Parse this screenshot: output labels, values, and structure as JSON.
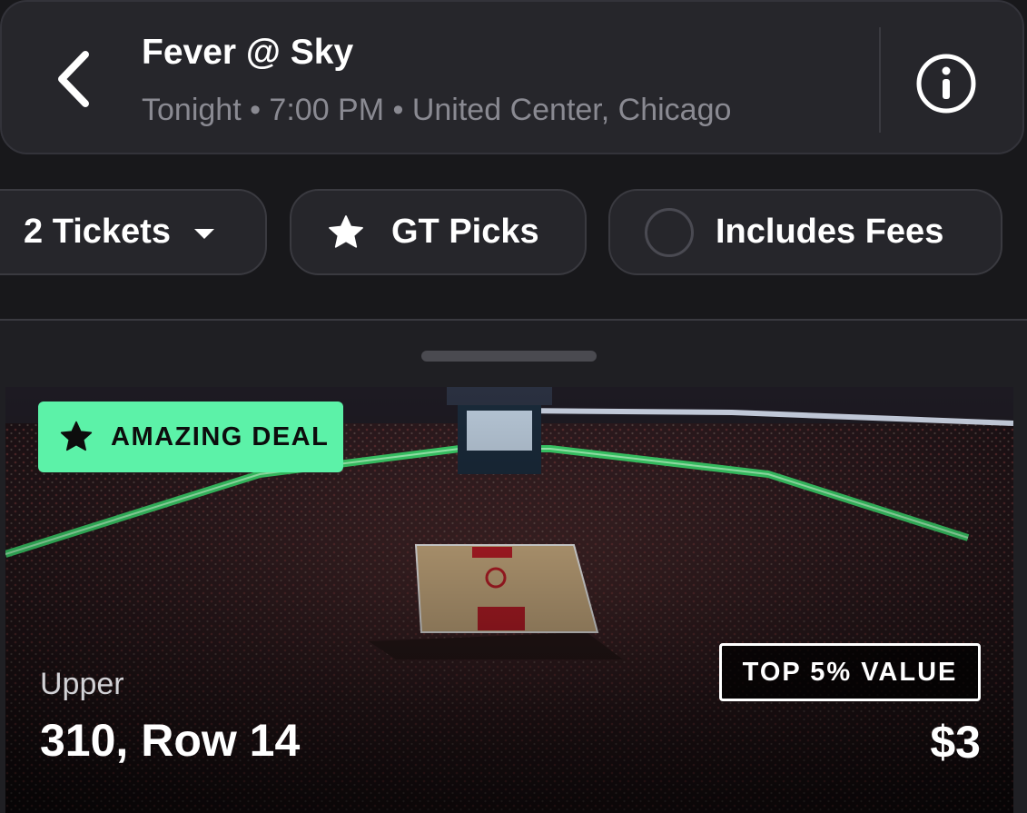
{
  "header": {
    "title": "Fever @ Sky",
    "meta": "Tonight • 7:00 PM • United Center, Chicago",
    "back_icon": "chevron-left-icon",
    "info_icon": "info-icon"
  },
  "filters": {
    "tickets_label": "2 Tickets",
    "picks_label": "GT Picks",
    "picks_icon": "star-icon",
    "fees_label": "Includes Fees",
    "fees_selected": false
  },
  "listing": {
    "badge": "AMAZING DEAL",
    "badge_icon": "star-icon",
    "value_tag": "TOP 5% VALUE",
    "level": "Upper",
    "section_row": "310, Row 14",
    "price": "$3",
    "image": "arena-view-image"
  },
  "colors": {
    "background": "#18181b",
    "surface": "#26262b",
    "badge_green": "#5cf2a8",
    "secondary_text": "#8a8a92"
  }
}
